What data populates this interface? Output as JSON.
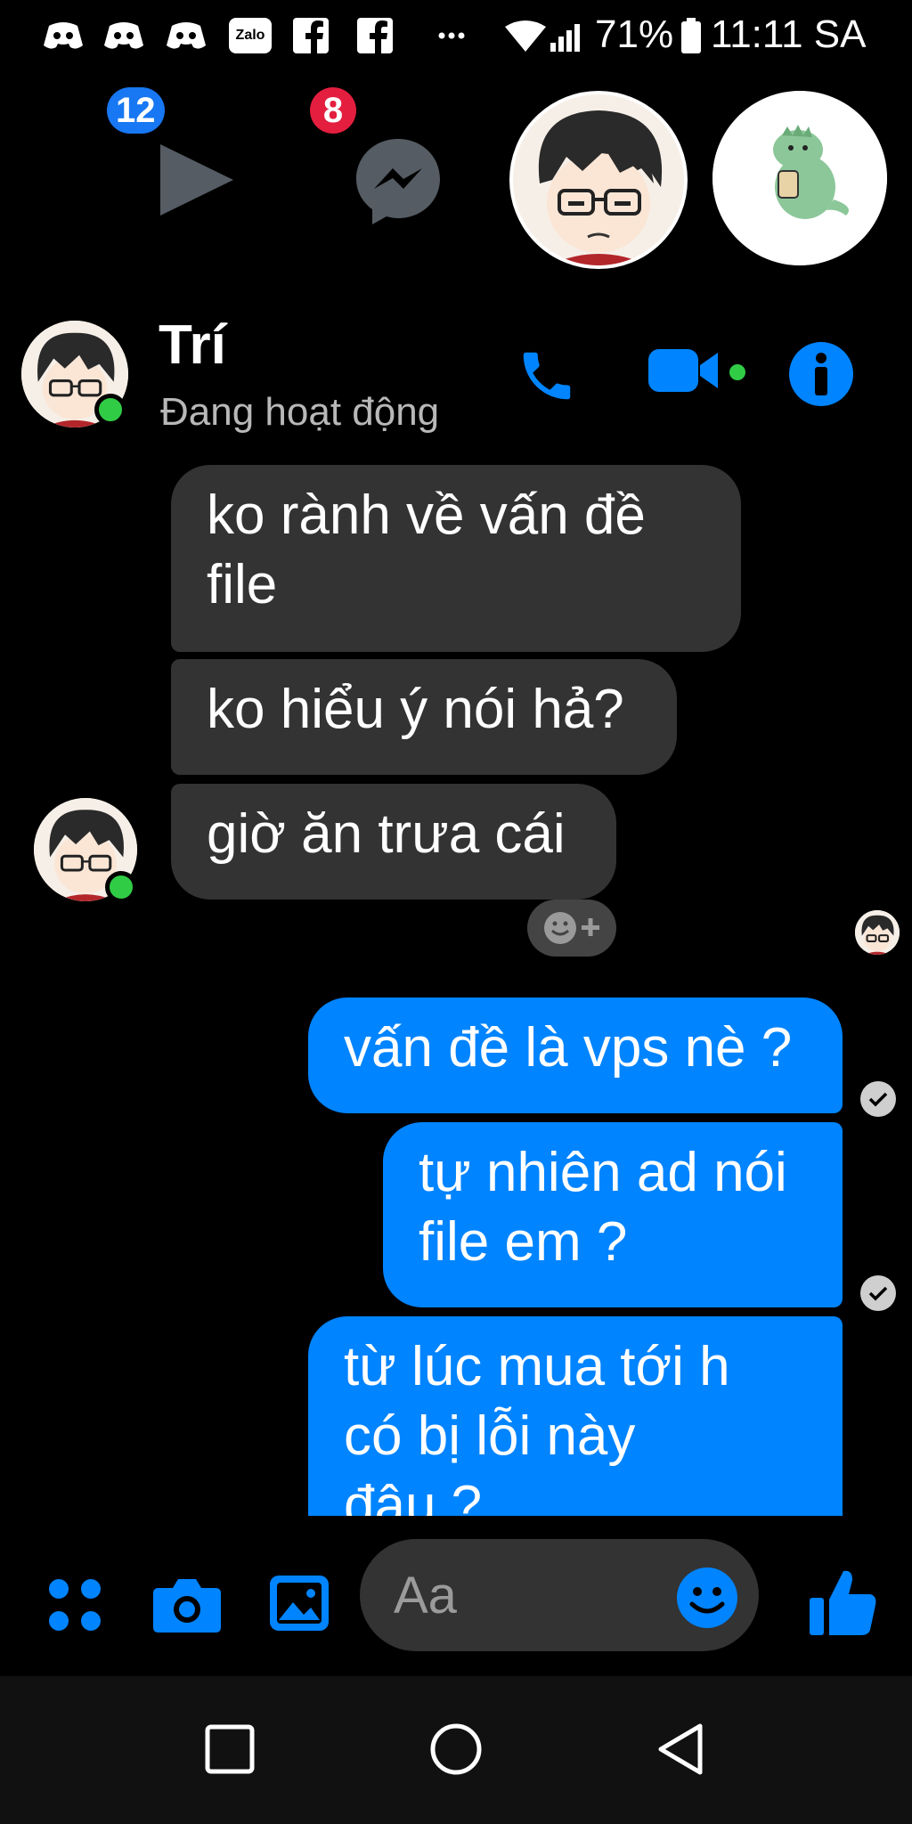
{
  "status_bar": {
    "notification_icons": [
      "discord-icon",
      "discord-icon",
      "discord-icon",
      "zalo-icon",
      "facebook-icon",
      "facebook-icon",
      "more-dots-icon"
    ],
    "zalo_label": "Zalo",
    "battery": "71%",
    "time": "11:11 SA"
  },
  "chat_heads": {
    "video_badge": "12",
    "messenger_badge": "8"
  },
  "header": {
    "name": "Trí",
    "status": "Đang hoạt động"
  },
  "messages": {
    "incoming": [
      {
        "text": "ko rành về vấn đề\nfile"
      },
      {
        "text": "ko hiểu ý nói hả?"
      },
      {
        "text": "giờ ăn trưa cái"
      }
    ],
    "outgoing": [
      {
        "text": "vấn đề là vps nè ?"
      },
      {
        "text": "tự nhiên ad nói\nfile em ?"
      },
      {
        "text": "từ lúc mua tới h\ncó bị lỗi này\nđâu ?"
      }
    ]
  },
  "composer": {
    "placeholder": "Aa"
  },
  "colors": {
    "accent": "#0084ff",
    "incoming_bubble": "#333333",
    "online": "#31cc46",
    "badge_blue": "#1877f2",
    "badge_red": "#e41e3f"
  }
}
